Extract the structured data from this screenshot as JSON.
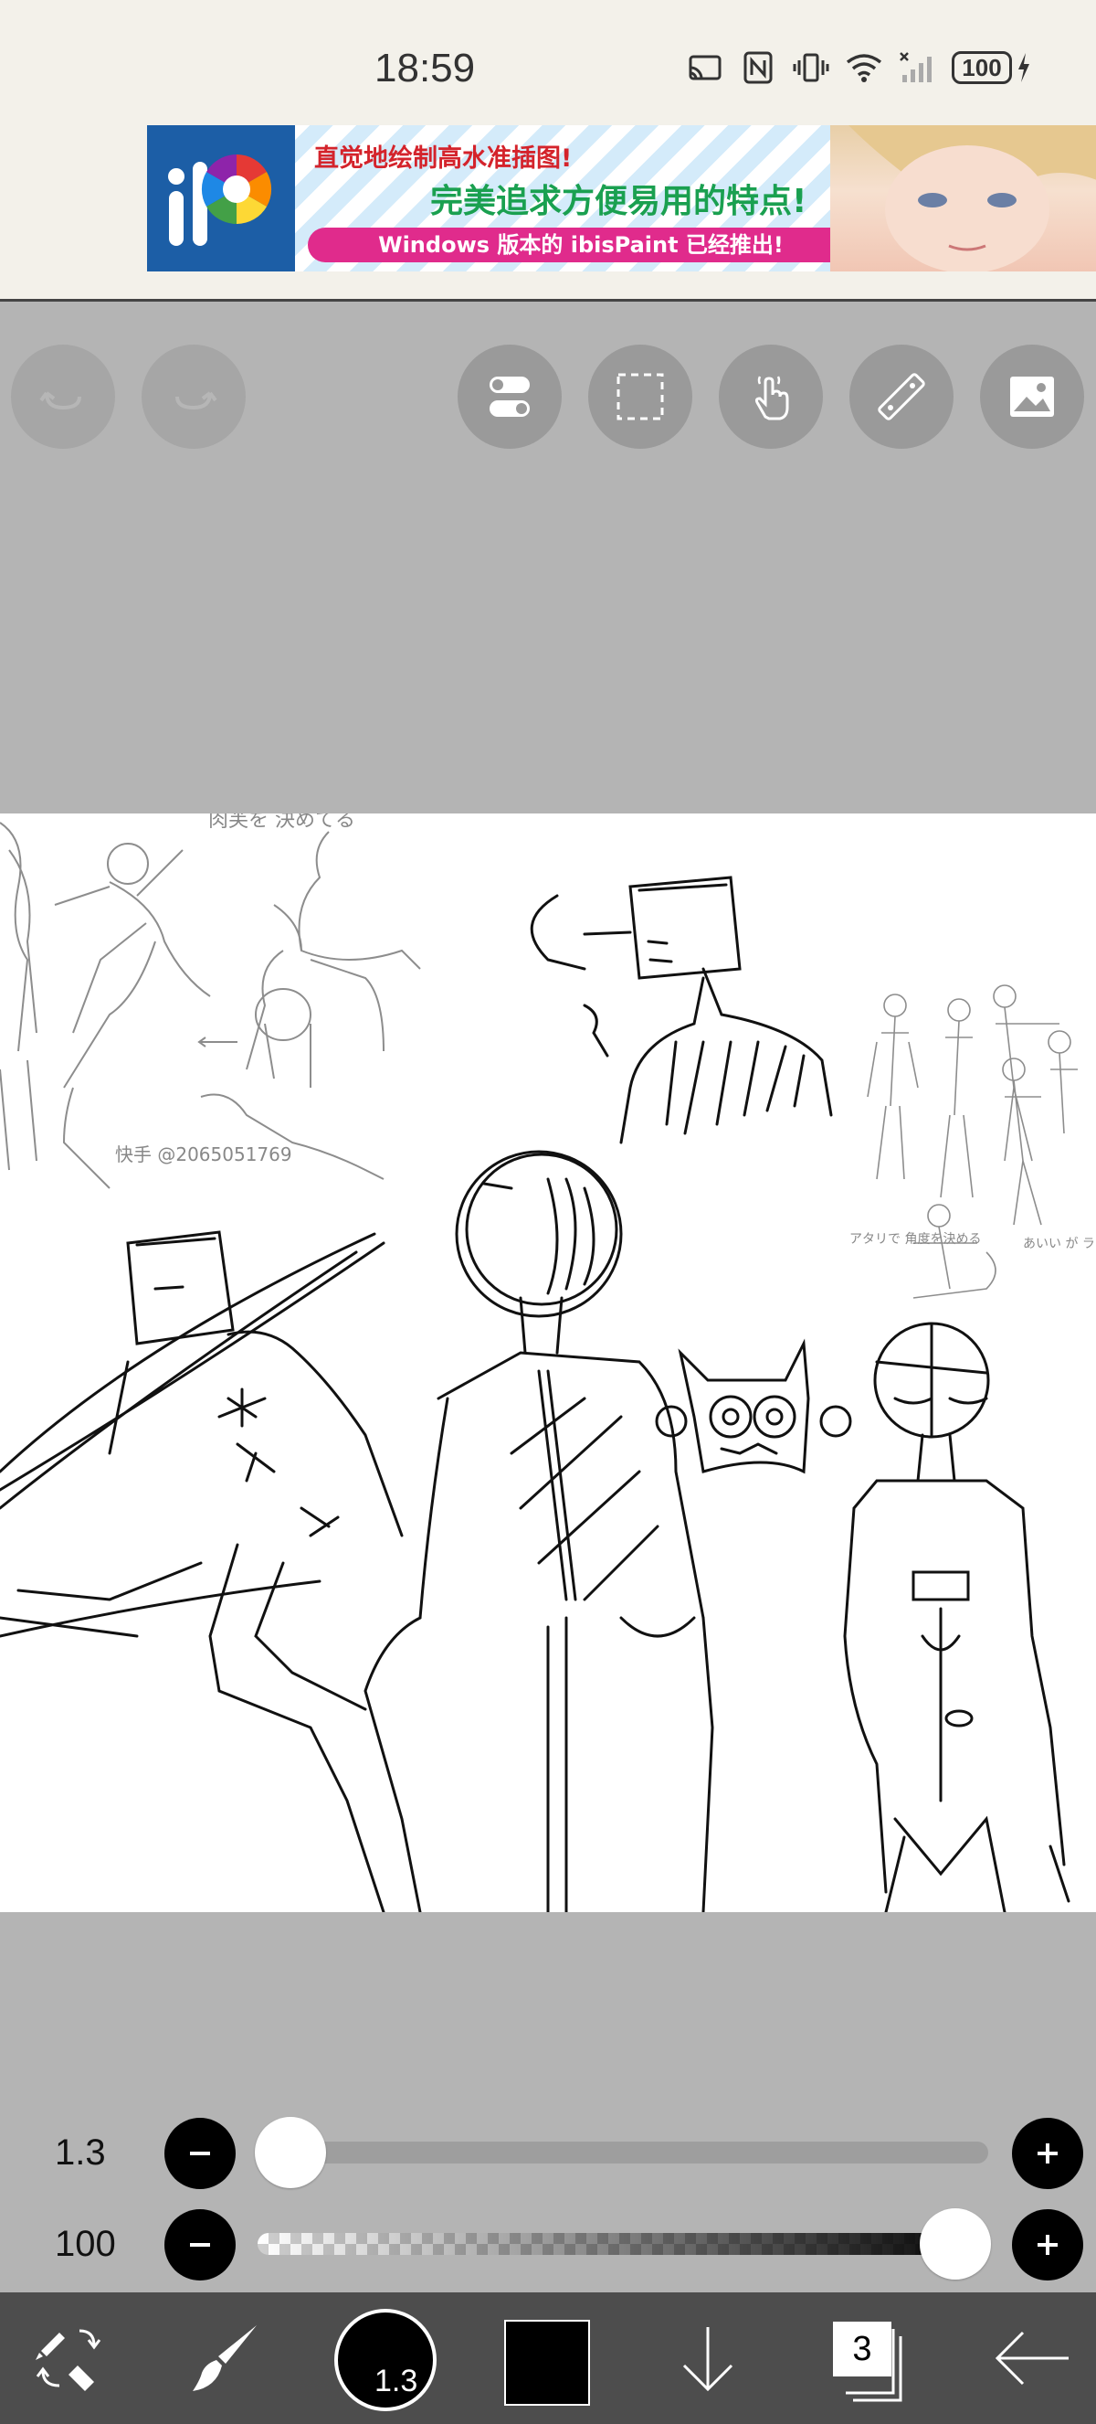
{
  "status_bar": {
    "time": "18:59",
    "battery": "100",
    "icons": [
      "cast-icon",
      "nfc-icon",
      "vibrate-icon",
      "wifi-icon",
      "signal-icon",
      "battery-icon",
      "charging-icon"
    ]
  },
  "ad": {
    "line1": "直觉地绘制高水准插图!",
    "line2": "完美追求方便易用的特点!",
    "line3": "Windows 版本的 ibisPaint 已经推出!",
    "logo_text": "iP",
    "colors": {
      "logo_bg": "#1c5ea6",
      "line1": "#d4232b",
      "line2": "#1aa050",
      "pill": "#e02b8c"
    }
  },
  "toolbar": {
    "buttons": [
      {
        "name": "undo-button",
        "icon": "undo-icon",
        "enabled": false
      },
      {
        "name": "redo-button",
        "icon": "redo-icon",
        "enabled": false
      },
      {
        "name": "toggle-button",
        "icon": "toggle-icon",
        "enabled": true
      },
      {
        "name": "selection-button",
        "icon": "selection-icon",
        "enabled": true
      },
      {
        "name": "gesture-button",
        "icon": "hand-icon",
        "enabled": true
      },
      {
        "name": "ruler-button",
        "icon": "ruler-icon",
        "enabled": true
      },
      {
        "name": "reference-button",
        "icon": "image-icon",
        "enabled": true
      }
    ]
  },
  "canvas": {
    "watermark": "快手 @2065051769",
    "note_top": "肉芙を 決めてる",
    "note_left": "アタリで 角度を決める",
    "note_right": "あいい が ラ フ"
  },
  "sliders": {
    "size": {
      "value": "1.3",
      "fraction": 0.0
    },
    "opacity": {
      "value": "100",
      "fraction": 1.0
    }
  },
  "bottom_bar": {
    "brush_size": "1.3",
    "layers": "3",
    "colors": {
      "bar_bg": "#4d4d4d",
      "swatch": "#000000"
    }
  }
}
